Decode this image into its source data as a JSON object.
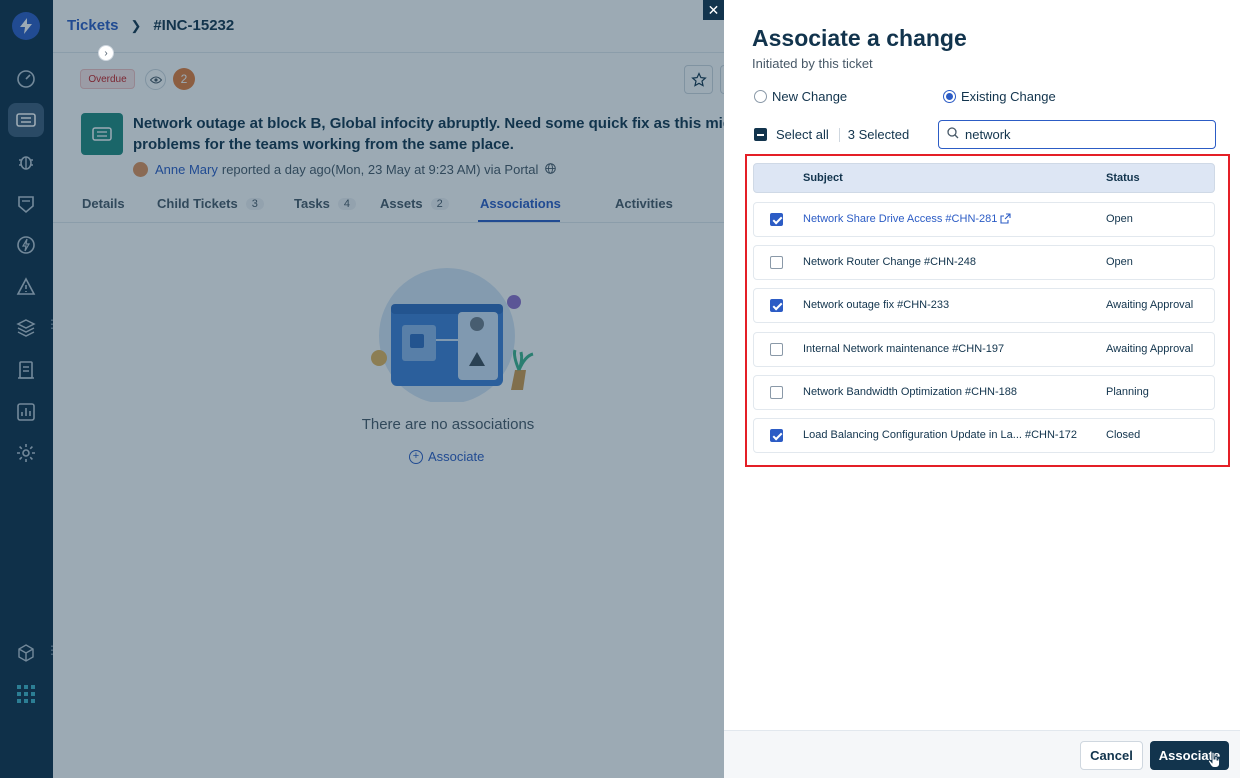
{
  "nav": {
    "items": [
      "home",
      "tickets",
      "problems",
      "changes",
      "releases",
      "alerts",
      "assets",
      "solutions",
      "analytics",
      "admin",
      "apps",
      "more-apps"
    ],
    "active": "tickets"
  },
  "breadcrumb": {
    "root": "Tickets",
    "current": "#INC-15232"
  },
  "ticket": {
    "badge": "Overdue",
    "watchers_count": "2",
    "title_line1": "Network outage at block B, Global infocity abruptly. Need some quick fix as this might c",
    "title_line2": "problems for the teams working from the same place.",
    "requester": "Anne Mary",
    "meta": "reported a day ago(Mon, 23 May at 9:23 AM) via Portal"
  },
  "tabs": [
    {
      "label": "Details",
      "count": ""
    },
    {
      "label": "Child Tickets",
      "count": "3"
    },
    {
      "label": "Tasks",
      "count": "4"
    },
    {
      "label": "Assets",
      "count": "2"
    },
    {
      "label": "Associations",
      "count": ""
    },
    {
      "label": "Activities",
      "count": ""
    }
  ],
  "empty_state": {
    "message": "There are no associations",
    "link": "Associate"
  },
  "panel": {
    "title": "Associate a change",
    "subtitle": "Initiated by this ticket",
    "radio_new": "New Change",
    "radio_existing": "Existing Change",
    "select_all": "Select all",
    "selected_count": "3 Selected",
    "search_value": "network",
    "columns": {
      "subject": "Subject",
      "status": "Status"
    },
    "rows": [
      {
        "subject": "Network Share Drive Access #CHN-281",
        "status": "Open",
        "checked": true,
        "link": true
      },
      {
        "subject": "Network Router Change #CHN-248",
        "status": "Open",
        "checked": false,
        "link": false
      },
      {
        "subject": "Network outage fix #CHN-233",
        "status": "Awaiting Approval",
        "checked": true,
        "link": false
      },
      {
        "subject": "Internal Network maintenance #CHN-197",
        "status": "Awaiting Approval",
        "checked": false,
        "link": false
      },
      {
        "subject": "Network Bandwidth Optimization #CHN-188",
        "status": "Planning",
        "checked": false,
        "link": false
      },
      {
        "subject": "Load Balancing Configuration Update in La... #CHN-172",
        "status": "Closed",
        "checked": true,
        "link": false
      }
    ],
    "cancel": "Cancel",
    "associate": "Associate"
  },
  "colors": {
    "accent": "#2c5cc5",
    "nav_bg": "#0d2d47",
    "primary_button": "#12344d",
    "highlight": "#e41f26"
  }
}
